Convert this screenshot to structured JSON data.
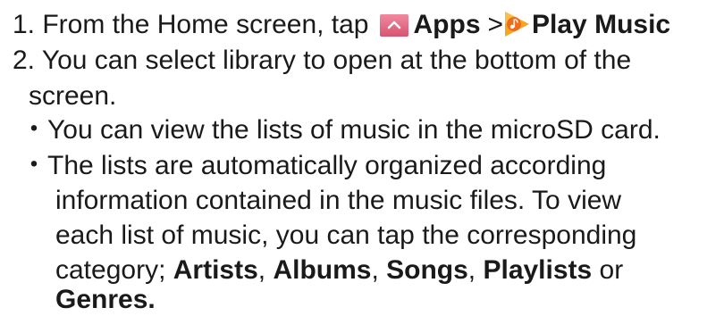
{
  "step1": {
    "text": "1. From the Home screen, tap",
    "apps_label": "Apps",
    "separator": ">",
    "play_music_label": "Play Music",
    "apps_icon": "apps-chevron-icon",
    "play_music_icon": "play-music-icon",
    "apps_icon_color": "#e0667c",
    "play_music_icon_color": "#f28a1e"
  },
  "step2": {
    "line1": "2. You can select library to open at the bottom of the",
    "line2": "screen."
  },
  "bullet1": {
    "text": "・You can view the lists of music in the microSD card."
  },
  "bullet2": {
    "line1": "・The lists are automatically organized according",
    "line2": "information contained in the music files. To view",
    "line3": "each list of music, you can tap the corresponding",
    "category_prefix": "category; ",
    "artists": "Artists",
    "comma1": ", ",
    "albums": "Albums",
    "comma2": ", ",
    "songs": "Songs",
    "comma3": ", ",
    "playlists": "Playlists",
    "or": " or",
    "genres": "Genres."
  }
}
